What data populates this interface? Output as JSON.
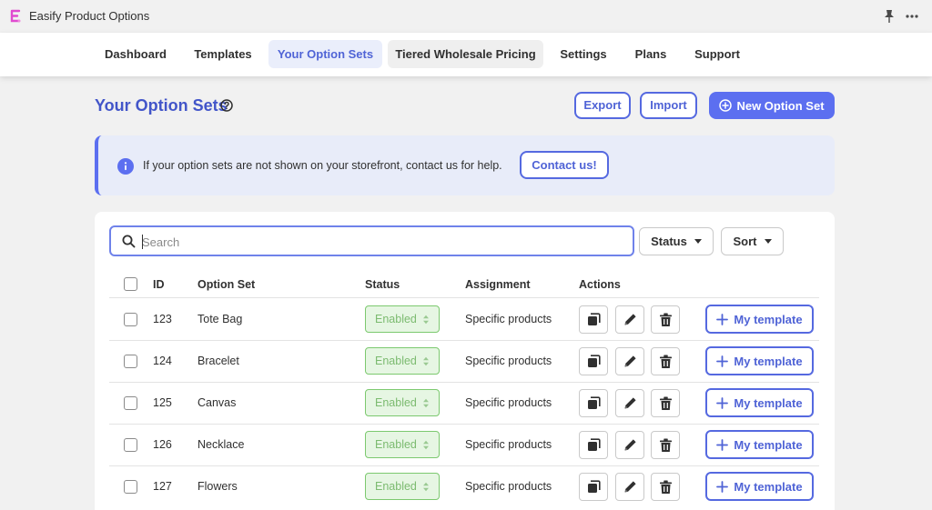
{
  "app": {
    "title": "Easify Product Options",
    "logo_icon": "easify-logo-icon",
    "accent": "#5c6ff0"
  },
  "topbar": {
    "pin_icon": "pin-icon",
    "more_icon": "more-icon"
  },
  "nav": {
    "tabs": [
      {
        "label": "Dashboard",
        "active": false
      },
      {
        "label": "Templates",
        "active": false
      },
      {
        "label": "Your Option Sets",
        "active": true
      },
      {
        "label": "Tiered Wholesale Pricing",
        "active": false
      },
      {
        "label": "Settings",
        "active": false
      },
      {
        "label": "Plans",
        "active": false
      },
      {
        "label": "Support",
        "active": false
      }
    ]
  },
  "page": {
    "title": "Your Option Sets",
    "export_label": "Export",
    "import_label": "Import",
    "new_label": "New Option Set"
  },
  "banner": {
    "text": "If your option sets are not shown on your storefront, contact us for help.",
    "button_label": "Contact us!"
  },
  "filters": {
    "search_placeholder": "Search",
    "status_label": "Status",
    "sort_label": "Sort"
  },
  "table": {
    "headers": {
      "id": "ID",
      "name": "Option Set",
      "status": "Status",
      "assignment": "Assignment",
      "actions": "Actions"
    },
    "rows": [
      {
        "id": "123",
        "name": "Tote Bag",
        "status": "Enabled",
        "assignment": "Specific products",
        "template_label": "My template"
      },
      {
        "id": "124",
        "name": "Bracelet",
        "status": "Enabled",
        "assignment": "Specific products",
        "template_label": "My template"
      },
      {
        "id": "125",
        "name": "Canvas",
        "status": "Enabled",
        "assignment": "Specific products",
        "template_label": "My template"
      },
      {
        "id": "126",
        "name": "Necklace",
        "status": "Enabled",
        "assignment": "Specific products",
        "template_label": "My template"
      },
      {
        "id": "127",
        "name": "Flowers",
        "status": "Enabled",
        "assignment": "Specific products",
        "template_label": "My template"
      }
    ],
    "action_icons": [
      "duplicate-icon",
      "edit-icon",
      "delete-icon"
    ]
  },
  "colors": {
    "status_enabled_bg": "#e6f6e3",
    "status_enabled_text": "#7cbb70",
    "title_color": "#4255c9"
  }
}
